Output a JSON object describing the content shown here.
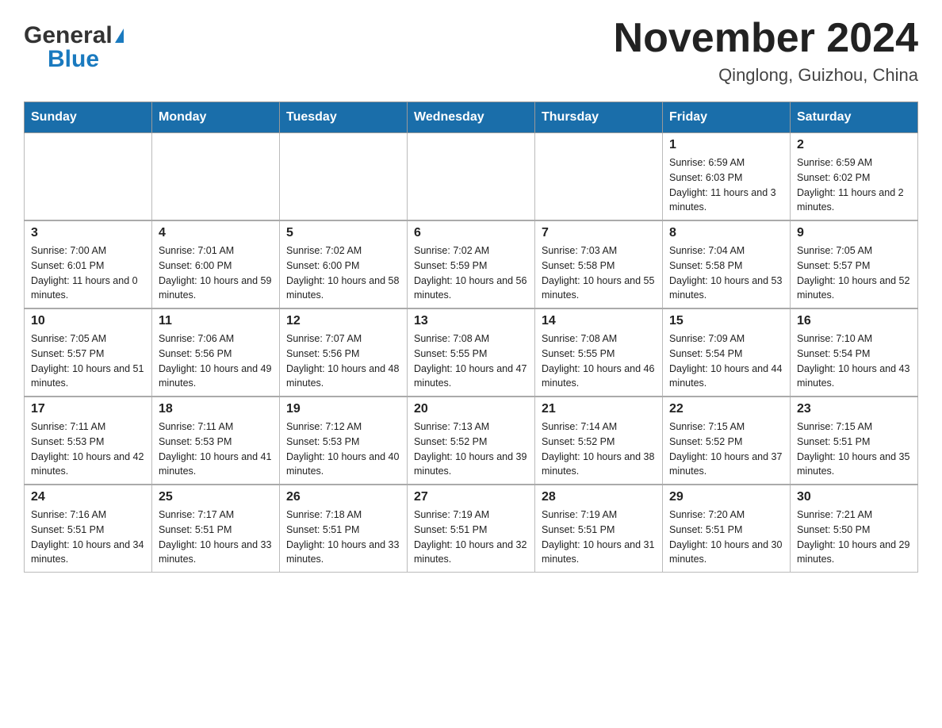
{
  "header": {
    "logo_general": "General",
    "logo_blue": "Blue",
    "month_title": "November 2024",
    "location": "Qinglong, Guizhou, China"
  },
  "calendar": {
    "days_of_week": [
      "Sunday",
      "Monday",
      "Tuesday",
      "Wednesday",
      "Thursday",
      "Friday",
      "Saturday"
    ],
    "weeks": [
      [
        {
          "day": "",
          "info": ""
        },
        {
          "day": "",
          "info": ""
        },
        {
          "day": "",
          "info": ""
        },
        {
          "day": "",
          "info": ""
        },
        {
          "day": "",
          "info": ""
        },
        {
          "day": "1",
          "info": "Sunrise: 6:59 AM\nSunset: 6:03 PM\nDaylight: 11 hours and 3 minutes."
        },
        {
          "day": "2",
          "info": "Sunrise: 6:59 AM\nSunset: 6:02 PM\nDaylight: 11 hours and 2 minutes."
        }
      ],
      [
        {
          "day": "3",
          "info": "Sunrise: 7:00 AM\nSunset: 6:01 PM\nDaylight: 11 hours and 0 minutes."
        },
        {
          "day": "4",
          "info": "Sunrise: 7:01 AM\nSunset: 6:00 PM\nDaylight: 10 hours and 59 minutes."
        },
        {
          "day": "5",
          "info": "Sunrise: 7:02 AM\nSunset: 6:00 PM\nDaylight: 10 hours and 58 minutes."
        },
        {
          "day": "6",
          "info": "Sunrise: 7:02 AM\nSunset: 5:59 PM\nDaylight: 10 hours and 56 minutes."
        },
        {
          "day": "7",
          "info": "Sunrise: 7:03 AM\nSunset: 5:58 PM\nDaylight: 10 hours and 55 minutes."
        },
        {
          "day": "8",
          "info": "Sunrise: 7:04 AM\nSunset: 5:58 PM\nDaylight: 10 hours and 53 minutes."
        },
        {
          "day": "9",
          "info": "Sunrise: 7:05 AM\nSunset: 5:57 PM\nDaylight: 10 hours and 52 minutes."
        }
      ],
      [
        {
          "day": "10",
          "info": "Sunrise: 7:05 AM\nSunset: 5:57 PM\nDaylight: 10 hours and 51 minutes."
        },
        {
          "day": "11",
          "info": "Sunrise: 7:06 AM\nSunset: 5:56 PM\nDaylight: 10 hours and 49 minutes."
        },
        {
          "day": "12",
          "info": "Sunrise: 7:07 AM\nSunset: 5:56 PM\nDaylight: 10 hours and 48 minutes."
        },
        {
          "day": "13",
          "info": "Sunrise: 7:08 AM\nSunset: 5:55 PM\nDaylight: 10 hours and 47 minutes."
        },
        {
          "day": "14",
          "info": "Sunrise: 7:08 AM\nSunset: 5:55 PM\nDaylight: 10 hours and 46 minutes."
        },
        {
          "day": "15",
          "info": "Sunrise: 7:09 AM\nSunset: 5:54 PM\nDaylight: 10 hours and 44 minutes."
        },
        {
          "day": "16",
          "info": "Sunrise: 7:10 AM\nSunset: 5:54 PM\nDaylight: 10 hours and 43 minutes."
        }
      ],
      [
        {
          "day": "17",
          "info": "Sunrise: 7:11 AM\nSunset: 5:53 PM\nDaylight: 10 hours and 42 minutes."
        },
        {
          "day": "18",
          "info": "Sunrise: 7:11 AM\nSunset: 5:53 PM\nDaylight: 10 hours and 41 minutes."
        },
        {
          "day": "19",
          "info": "Sunrise: 7:12 AM\nSunset: 5:53 PM\nDaylight: 10 hours and 40 minutes."
        },
        {
          "day": "20",
          "info": "Sunrise: 7:13 AM\nSunset: 5:52 PM\nDaylight: 10 hours and 39 minutes."
        },
        {
          "day": "21",
          "info": "Sunrise: 7:14 AM\nSunset: 5:52 PM\nDaylight: 10 hours and 38 minutes."
        },
        {
          "day": "22",
          "info": "Sunrise: 7:15 AM\nSunset: 5:52 PM\nDaylight: 10 hours and 37 minutes."
        },
        {
          "day": "23",
          "info": "Sunrise: 7:15 AM\nSunset: 5:51 PM\nDaylight: 10 hours and 35 minutes."
        }
      ],
      [
        {
          "day": "24",
          "info": "Sunrise: 7:16 AM\nSunset: 5:51 PM\nDaylight: 10 hours and 34 minutes."
        },
        {
          "day": "25",
          "info": "Sunrise: 7:17 AM\nSunset: 5:51 PM\nDaylight: 10 hours and 33 minutes."
        },
        {
          "day": "26",
          "info": "Sunrise: 7:18 AM\nSunset: 5:51 PM\nDaylight: 10 hours and 33 minutes."
        },
        {
          "day": "27",
          "info": "Sunrise: 7:19 AM\nSunset: 5:51 PM\nDaylight: 10 hours and 32 minutes."
        },
        {
          "day": "28",
          "info": "Sunrise: 7:19 AM\nSunset: 5:51 PM\nDaylight: 10 hours and 31 minutes."
        },
        {
          "day": "29",
          "info": "Sunrise: 7:20 AM\nSunset: 5:51 PM\nDaylight: 10 hours and 30 minutes."
        },
        {
          "day": "30",
          "info": "Sunrise: 7:21 AM\nSunset: 5:50 PM\nDaylight: 10 hours and 29 minutes."
        }
      ]
    ]
  }
}
